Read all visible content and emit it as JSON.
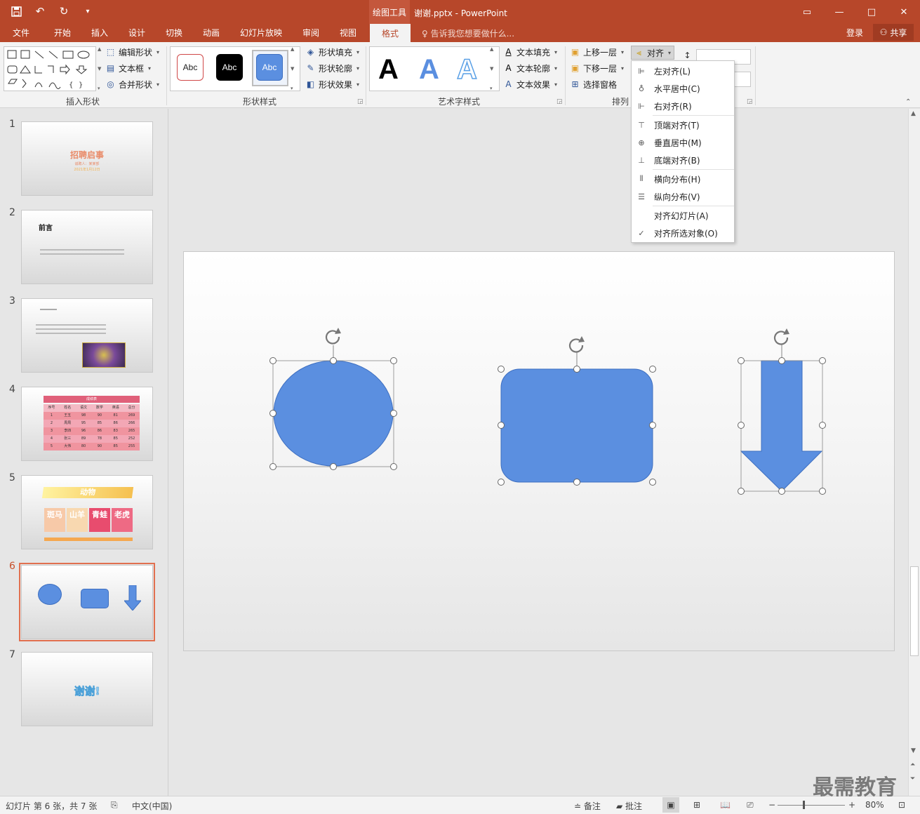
{
  "titlebar": {
    "context_tab": "绘图工具",
    "document_title": "谢谢.pptx - PowerPoint",
    "min_icon": "—",
    "restore_icon": "□",
    "close_icon": "✕",
    "ribbon_toggle_icon": "▭"
  },
  "tabs": {
    "file": "文件",
    "home": "开始",
    "insert": "插入",
    "design": "设计",
    "transitions": "切换",
    "animations": "动画",
    "slideshow": "幻灯片放映",
    "review": "审阅",
    "view": "视图",
    "format": "格式",
    "tell_me": "告诉我您想要做什么...",
    "login": "登录",
    "share": "共享"
  },
  "ribbon": {
    "insert_shapes": {
      "label": "插入形状",
      "edit_shape": "编辑形状",
      "text_box": "文本框",
      "merge_shapes": "合并形状"
    },
    "shape_styles": {
      "label": "形状样式",
      "swatch_text": "Abc",
      "fill": "形状填充",
      "outline": "形状轮廓",
      "effects": "形状效果"
    },
    "wordart_styles": {
      "label": "艺术字样式",
      "letter": "A",
      "text_fill": "文本填充",
      "text_outline": "文本轮廓",
      "text_effects": "文本效果"
    },
    "arrange": {
      "label": "排列",
      "bring_forward": "上移一层",
      "send_backward": "下移一层",
      "selection_pane": "选择窗格",
      "align": "对齐"
    }
  },
  "align_menu": {
    "items": [
      {
        "label": "左对齐(L)",
        "icon": "align-left-icon"
      },
      {
        "label": "水平居中(C)",
        "icon": "align-center-icon"
      },
      {
        "label": "右对齐(R)",
        "icon": "align-right-icon"
      },
      {
        "label": "顶端对齐(T)",
        "icon": "align-top-icon"
      },
      {
        "label": "垂直居中(M)",
        "icon": "align-middle-icon"
      },
      {
        "label": "底端对齐(B)",
        "icon": "align-bottom-icon"
      },
      {
        "label": "横向分布(H)",
        "icon": "distribute-horizontal-icon"
      },
      {
        "label": "纵向分布(V)",
        "icon": "distribute-vertical-icon"
      },
      {
        "label": "对齐幻灯片(A)",
        "icon": ""
      },
      {
        "label": "对齐所选对象(O)",
        "icon": "checkmark-icon",
        "checked": true
      }
    ]
  },
  "thumbnails": {
    "numbers": [
      "1",
      "2",
      "3",
      "4",
      "5",
      "6",
      "7"
    ],
    "active": "6",
    "slide1": {
      "title": "招聘启事",
      "sub1": "诚聘人：某某部",
      "sub2": "2021年1月12日"
    },
    "slide2": {
      "title": "前言"
    },
    "slide4": {
      "table_title": "成绩表",
      "headers": [
        "序号",
        "姓名",
        "语文",
        "数学",
        "英语",
        "总分"
      ],
      "rows": [
        [
          "1",
          "王五",
          "98",
          "90",
          "81",
          "269"
        ],
        [
          "2",
          "周周",
          "95",
          "85",
          "86",
          "266"
        ],
        [
          "3",
          "李四",
          "96",
          "86",
          "83",
          "265"
        ],
        [
          "4",
          "张三",
          "89",
          "78",
          "85",
          "252"
        ],
        [
          "5",
          "大伟",
          "80",
          "90",
          "85",
          "255"
        ]
      ]
    },
    "slide5": {
      "title": "动物",
      "cards": [
        "斑马",
        "山羊",
        "青蛙",
        "老虎"
      ]
    },
    "slide7": {
      "title": "谢谢!"
    }
  },
  "colors": {
    "accent": "#b7472a",
    "shape_fill": "#5b8fe0",
    "shape_stroke": "#3e6fc0"
  },
  "statusbar": {
    "slide_info": "幻灯片 第 6 张，共 7 张",
    "language": "中文(中国)",
    "notes": "备注",
    "comments": "批注",
    "zoom": "80%"
  },
  "watermark": "最需教育"
}
